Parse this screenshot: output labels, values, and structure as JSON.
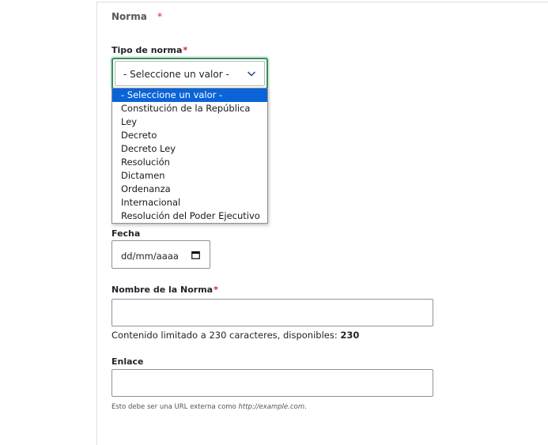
{
  "section": {
    "title": "Norma",
    "required_mark": "*"
  },
  "tipo_norma": {
    "label": "Tipo de norma",
    "required_mark": "*",
    "selected_value": "- Seleccione un valor -",
    "options": [
      "- Seleccione un valor -",
      "Constitución de la República",
      "Ley",
      "Decreto",
      "Decreto Ley",
      "Resolución",
      "Dictamen",
      "Ordenanza",
      "Internacional",
      "Resolución del Poder Ejecutivo"
    ]
  },
  "fecha": {
    "label": "Fecha",
    "placeholder": "dd/mm/aaaa"
  },
  "nombre": {
    "label": "Nombre de la Norma",
    "required_mark": "*",
    "value": "",
    "help_prefix": "Contenido limitado a 230 caracteres, disponibles: ",
    "help_count": "230"
  },
  "enlace": {
    "label": "Enlace",
    "value": "",
    "desc_prefix": "Esto debe ser una URL externa como ",
    "desc_example": "http://example.com",
    "desc_suffix": "."
  },
  "colors": {
    "focus_border": "#3a8f5e",
    "selected_option_bg": "#0a64d8",
    "required": "#d72222"
  }
}
